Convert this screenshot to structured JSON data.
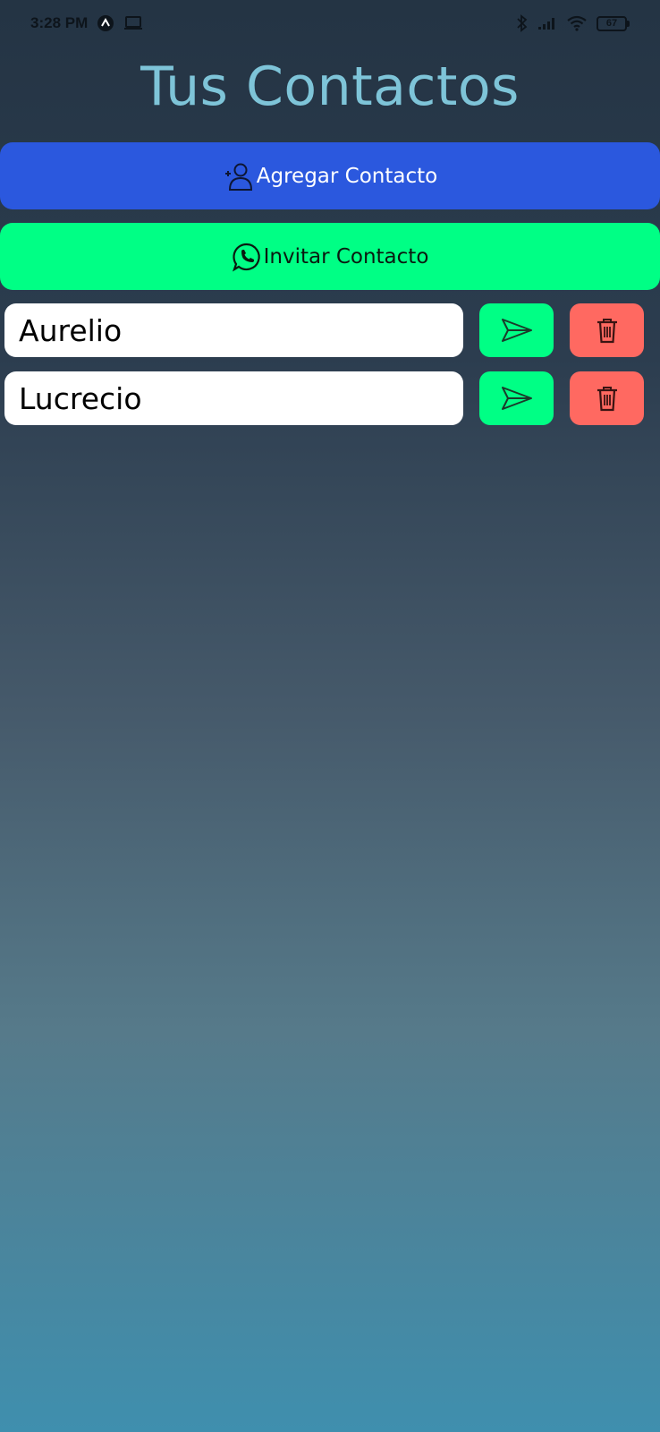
{
  "status_bar": {
    "time": "3:28 PM",
    "battery": "67",
    "icons": [
      "app-notification-icon",
      "laptop-icon",
      "bluetooth-icon",
      "signal-icon",
      "wifi-icon",
      "battery-icon"
    ]
  },
  "header": {
    "title": "Tus Contactos"
  },
  "actions": {
    "add_label": "Agregar Contacto",
    "add_icon": "add-person-icon",
    "invite_label": "Invitar Contacto",
    "invite_icon": "whatsapp-icon"
  },
  "contacts": [
    {
      "name": "Aurelio",
      "send_icon": "send-icon",
      "delete_icon": "trash-icon"
    },
    {
      "name": "Lucrecio",
      "send_icon": "send-icon",
      "delete_icon": "trash-icon"
    }
  ],
  "colors": {
    "title": "#7ec4d8",
    "add_button": "#2b58de",
    "invite_button": "#00ff85",
    "send_button": "#00ff85",
    "delete_button": "#ff6961",
    "background_top": "#243444",
    "background_bottom": "#3f8fae"
  }
}
